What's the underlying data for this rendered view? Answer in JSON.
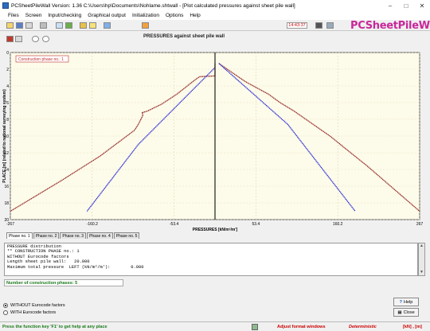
{
  "window": {
    "title": "PCSheetPileWall  Version: 1.36  C:\\Users\\hp\\Documents\\Nohlame.shtwall - [Plot calculated pressures against sheet pile wall]"
  },
  "menu": [
    "Files",
    "Screen",
    "Input/checking",
    "Graphical output",
    "Initialization",
    "Options",
    "Help"
  ],
  "toolbar": {
    "clock": "14:43:37"
  },
  "brand": "PCSheetPileWall",
  "plot": {
    "title": "PRESSURES against sheet pile wall",
    "box_label": "Construction phase no.: 1"
  },
  "chart_data": {
    "type": "line",
    "xlabel": "PRESSURES [kN/m²/m']",
    "ylabel": "PLACE [m]   (related to national surveying system)",
    "xlim": [
      -267,
      267
    ],
    "ylim": [
      20,
      0
    ],
    "x_ticks": [
      "-267",
      "-160.2",
      "-53.4",
      "53.4",
      "160.2",
      "267"
    ],
    "y_ticks": [
      "0",
      "2",
      "4",
      "6",
      "8",
      "10",
      "12",
      "14",
      "16",
      "18",
      "20"
    ],
    "series": [
      {
        "color": "#8b1a1a",
        "points": [
          [
            0,
            1.3
          ],
          [
            0,
            2.8
          ],
          [
            -20,
            2.9
          ],
          [
            -25,
            3.2
          ],
          [
            -50,
            5.0
          ],
          [
            -70,
            6.2
          ],
          [
            -88,
            7.0
          ],
          [
            -95,
            7.2
          ],
          [
            -94,
            7.5
          ],
          [
            -100,
            8.6
          ],
          [
            -105,
            9.3
          ],
          [
            -150,
            12.4
          ],
          [
            -200,
            15.3
          ],
          [
            -267,
            19.0
          ]
        ]
      },
      {
        "color": "#8b1a1a",
        "points": [
          [
            5,
            1.3
          ],
          [
            40,
            3.5
          ],
          [
            70,
            5.0
          ],
          [
            85,
            6.0
          ],
          [
            103,
            7.0
          ],
          [
            150,
            10.0
          ],
          [
            200,
            13.7
          ],
          [
            267,
            19.0
          ]
        ]
      },
      {
        "color": "#1f1fd6",
        "points": [
          [
            0,
            1.8
          ],
          [
            -100,
            11.0
          ],
          [
            -167,
            19.0
          ]
        ]
      },
      {
        "color": "#1f1fd6",
        "points": [
          [
            5,
            1.3
          ],
          [
            95,
            8.6
          ],
          [
            183,
            19.0
          ]
        ]
      }
    ]
  },
  "tabs": [
    "Phase no. 1",
    "Phase no. 2",
    "Phase no. 3",
    "Phase no. 4",
    "Phase no. 5"
  ],
  "output_text": [
    "PRESSURE distribution",
    "** CONSTRUCTION PHASE no.: 1",
    "WITHOUT Eurocode factors",
    "Length sheet pile wall:   20.000",
    "Maximum total pressure  LEFT (kN/m²/m'):        0.000"
  ],
  "phase_count": "Number of construction phases: 5",
  "options": [
    {
      "label": "WITHOUT Eurocode factors",
      "selected": true
    },
    {
      "label": "WITH Eurocode factors",
      "selected": false
    }
  ],
  "buttons": {
    "help": "Help",
    "close": "Close"
  },
  "status": {
    "hint": "Press the function key 'F1' to get help at any place",
    "adjust": "Adjust format windows",
    "mode": "Deterministic",
    "units": "[kN] , [m]"
  }
}
